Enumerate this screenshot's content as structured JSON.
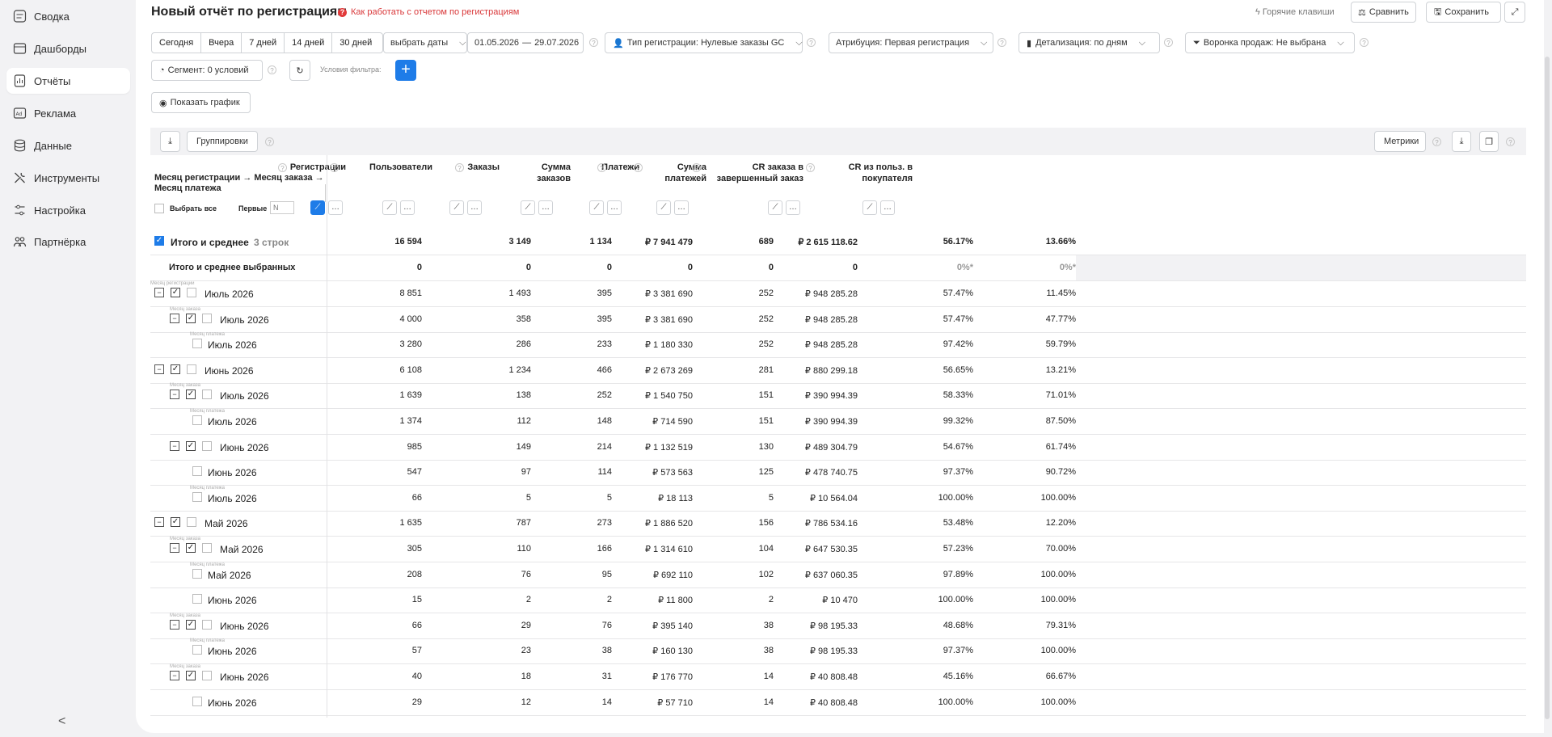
{
  "sidebar": {
    "items": [
      {
        "label": "Сводка",
        "icon": "summary-icon"
      },
      {
        "label": "Дашборды",
        "icon": "dashboard-icon"
      },
      {
        "label": "Отчёты",
        "icon": "reports-icon",
        "active": true
      },
      {
        "label": "Реклама",
        "icon": "ads-icon"
      },
      {
        "label": "Данные",
        "icon": "database-icon"
      },
      {
        "label": "Инструменты",
        "icon": "tools-icon"
      },
      {
        "label": "Настройка",
        "icon": "settings-icon"
      },
      {
        "label": "Партнёрка",
        "icon": "partners-icon"
      }
    ],
    "collapse": "<"
  },
  "header": {
    "title": "Новый отчёт по регистрациям",
    "help_link": "Как работать с отчетом по регистрациям",
    "hotkeys": "Горячие клавиши",
    "compare": "Сравнить",
    "save": "Сохранить"
  },
  "toolbar": {
    "periods": [
      "Сегодня",
      "Вчера",
      "7 дней",
      "14 дней",
      "30 дней"
    ],
    "choose_dates": "выбрать даты",
    "date_from": "01.05.2026",
    "date_sep": "—",
    "date_to": "29.07.2026",
    "registration_type": "Тип регистрации: Нулевые заказы GC",
    "attribution": "Атрибуция: Первая регистрация",
    "detail": "Детализация:  по дням",
    "funnel": "Воронка продаж: Не выбрана",
    "segment": "Сегмент: 0 условий",
    "filter_label": "Условия фильтра:",
    "show_chart": "Показать график"
  },
  "table": {
    "groupings": "Группировки",
    "metrics": "Метрики",
    "group_header": "Месяц регистрации → Месяц заказа → Месяц платежа",
    "select_all": "Выбрать все",
    "first": "Первые",
    "first_placeholder": "N",
    "columns": [
      "Регистрации",
      "Пользователи",
      "Заказы",
      "Сумма заказов",
      "Платежи",
      "Сумма платежей",
      "CR заказа в завершенный заказ",
      "CR из польз. в покупателя"
    ],
    "total": {
      "label": "Итого и среднее",
      "count": "3 строк",
      "values": [
        "16 594",
        "3 149",
        "1 134",
        "₽ 7 941 479",
        "689",
        "₽ 2 615 118.62",
        "56.17%",
        "13.66%"
      ]
    },
    "selected": {
      "label": "Итого и среднее выбранных",
      "values": [
        "0",
        "0",
        "0",
        "0",
        "0",
        "0",
        "0%*",
        "0%*"
      ]
    },
    "rows": [
      {
        "level": 0,
        "caption": "Месяц регистрации",
        "label": "Июль 2026",
        "values": [
          "8 851",
          "1 493",
          "395",
          "₽ 3 381 690",
          "252",
          "₽ 948 285.28",
          "57.47%",
          "11.45%"
        ]
      },
      {
        "level": 1,
        "caption": "Месяц заказа",
        "label": "Июль 2026",
        "values": [
          "4 000",
          "358",
          "395",
          "₽ 3 381 690",
          "252",
          "₽ 948 285.28",
          "57.47%",
          "47.77%"
        ]
      },
      {
        "level": 2,
        "caption": "Месяц платежа",
        "label": "Июль 2026",
        "values": [
          "3 280",
          "286",
          "233",
          "₽ 1 180 330",
          "252",
          "₽ 948 285.28",
          "97.42%",
          "59.79%"
        ]
      },
      {
        "level": 0,
        "caption": "",
        "label": "Июнь 2026",
        "values": [
          "6 108",
          "1 234",
          "466",
          "₽ 2 673 269",
          "281",
          "₽ 880 299.18",
          "56.65%",
          "13.21%"
        ]
      },
      {
        "level": 1,
        "caption": "Месяц заказа",
        "label": "Июль 2026",
        "values": [
          "1 639",
          "138",
          "252",
          "₽ 1 540 750",
          "151",
          "₽ 390 994.39",
          "58.33%",
          "71.01%"
        ]
      },
      {
        "level": 2,
        "caption": "Месяц платежа",
        "label": "Июль 2026",
        "values": [
          "1 374",
          "112",
          "148",
          "₽ 714 590",
          "151",
          "₽ 390 994.39",
          "99.32%",
          "87.50%"
        ]
      },
      {
        "level": 1,
        "caption": "",
        "label": "Июнь 2026",
        "values": [
          "985",
          "149",
          "214",
          "₽ 1 132 519",
          "130",
          "₽ 489 304.79",
          "54.67%",
          "61.74%"
        ]
      },
      {
        "level": 2,
        "caption": "",
        "label": "Июнь 2026",
        "values": [
          "547",
          "97",
          "114",
          "₽ 573 563",
          "125",
          "₽ 478 740.75",
          "97.37%",
          "90.72%"
        ]
      },
      {
        "level": 2,
        "caption": "Месяц платежа",
        "label": "Июль 2026",
        "values": [
          "66",
          "5",
          "5",
          "₽ 18 113",
          "5",
          "₽ 10 564.04",
          "100.00%",
          "100.00%"
        ]
      },
      {
        "level": 0,
        "caption": "",
        "label": "Май 2026",
        "values": [
          "1 635",
          "787",
          "273",
          "₽ 1 886 520",
          "156",
          "₽ 786 534.16",
          "53.48%",
          "12.20%"
        ]
      },
      {
        "level": 1,
        "caption": "Месяц заказа",
        "label": "Май 2026",
        "values": [
          "305",
          "110",
          "166",
          "₽ 1 314 610",
          "104",
          "₽ 647 530.35",
          "57.23%",
          "70.00%"
        ]
      },
      {
        "level": 2,
        "caption": "Месяц платежа",
        "label": "Май 2026",
        "values": [
          "208",
          "76",
          "95",
          "₽ 692 110",
          "102",
          "₽ 637 060.35",
          "97.89%",
          "100.00%"
        ]
      },
      {
        "level": 2,
        "caption": "",
        "label": "Июнь 2026",
        "values": [
          "15",
          "2",
          "2",
          "₽ 11 800",
          "2",
          "₽ 10 470",
          "100.00%",
          "100.00%"
        ]
      },
      {
        "level": 1,
        "caption": "Месяц заказа",
        "label": "Июнь 2026",
        "values": [
          "66",
          "29",
          "76",
          "₽ 395 140",
          "38",
          "₽ 98 195.33",
          "48.68%",
          "79.31%"
        ]
      },
      {
        "level": 2,
        "caption": "Месяц платежа",
        "label": "Июнь 2026",
        "values": [
          "57",
          "23",
          "38",
          "₽ 160 130",
          "38",
          "₽ 98 195.33",
          "97.37%",
          "100.00%"
        ]
      },
      {
        "level": 1,
        "caption": "Месяц заказа",
        "label": "Июнь 2026",
        "values": [
          "40",
          "18",
          "31",
          "₽ 176 770",
          "14",
          "₽ 40 808.48",
          "45.16%",
          "66.67%"
        ]
      },
      {
        "level": 2,
        "caption": "",
        "label": "Июнь 2026",
        "values": [
          "29",
          "12",
          "14",
          "₽ 57 710",
          "14",
          "₽ 40 808.48",
          "100.00%",
          "100.00%"
        ]
      }
    ]
  },
  "colors": {
    "accent": "#1e7ce8",
    "help": "#d9383a",
    "sidebar_bg": "#f2f2f4"
  }
}
